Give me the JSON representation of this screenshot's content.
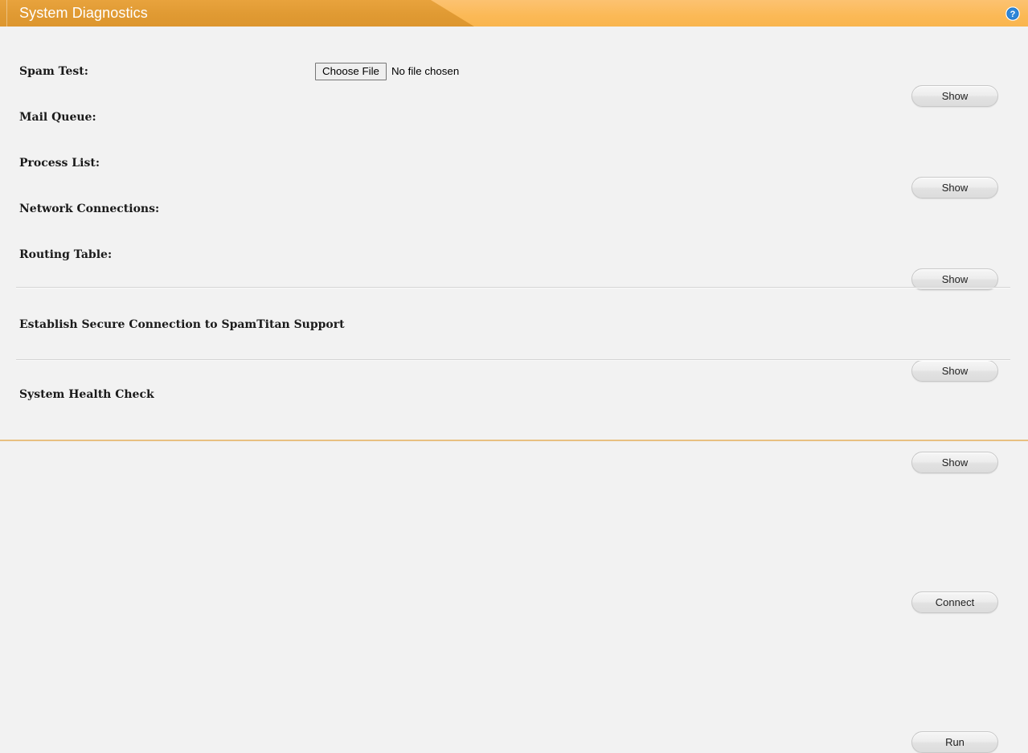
{
  "header": {
    "title": "System Diagnostics",
    "help_icon": "help-circle-icon",
    "bar_color_dark": "#e09a33",
    "bar_color_light": "#fbb956",
    "title_color": "#ffffff"
  },
  "page": {
    "background": "#f2f2f2",
    "bottom_border_color": "#e8c081"
  },
  "diagnostics": {
    "rows": [
      {
        "label": "Spam Test:",
        "has_file_input": true,
        "file_button_label": "Choose File",
        "file_status_text": "No file chosen",
        "action_label": "Show",
        "action_name": "show-spam-test-button"
      },
      {
        "label": "Mail Queue:",
        "has_file_input": false,
        "action_label": "Show",
        "action_name": "show-mail-queue-button"
      },
      {
        "label": "Process List:",
        "has_file_input": false,
        "action_label": "Show",
        "action_name": "show-process-list-button"
      },
      {
        "label": "Network Connections:",
        "has_file_input": false,
        "action_label": "Show",
        "action_name": "show-network-connections-button"
      },
      {
        "label": "Routing Table:",
        "has_file_input": false,
        "action_label": "Show",
        "action_name": "show-routing-table-button"
      }
    ]
  },
  "support": {
    "label": "Establish Secure Connection to SpamTitan Support",
    "action_label": "Connect"
  },
  "health": {
    "label": "System Health Check",
    "action_label": "Run"
  }
}
